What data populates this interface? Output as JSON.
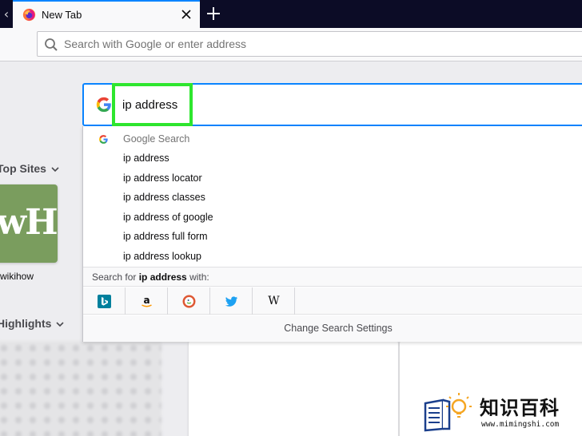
{
  "browser": {
    "tab": {
      "title": "New Tab",
      "close_glyph": "×"
    },
    "new_tab_glyph": "+",
    "urlbar": {
      "placeholder": "Search with Google or enter address"
    }
  },
  "newtab": {
    "top_sites": {
      "title": "Top Sites",
      "tile": {
        "logo_text": "wH",
        "label": "wikihow"
      }
    },
    "highlights": {
      "title": "Highlights"
    }
  },
  "search": {
    "query": "ip address",
    "engine_icon": "google-g-icon",
    "dropdown": {
      "header": "Google Search",
      "suggestions": [
        "ip address",
        "ip address locator",
        "ip address classes",
        "ip address of google",
        "ip address full form",
        "ip address lookup"
      ],
      "search_for_prefix": "Search for ",
      "search_for_term": "ip address",
      "search_for_suffix": " with:",
      "engines": [
        "bing-icon",
        "amazon-icon",
        "duckduckgo-icon",
        "twitter-icon",
        "wikipedia-icon"
      ],
      "wikipedia_glyph": "W",
      "settings_label": "Change Search Settings"
    }
  },
  "watermark": {
    "title": "知识百科",
    "url": "www.mimingshi.com"
  },
  "colors": {
    "accent": "#0a84ff",
    "highlight_box": "#2ee62e",
    "tabstrip": "#0c0c26",
    "tile": "#7a9d5e"
  }
}
